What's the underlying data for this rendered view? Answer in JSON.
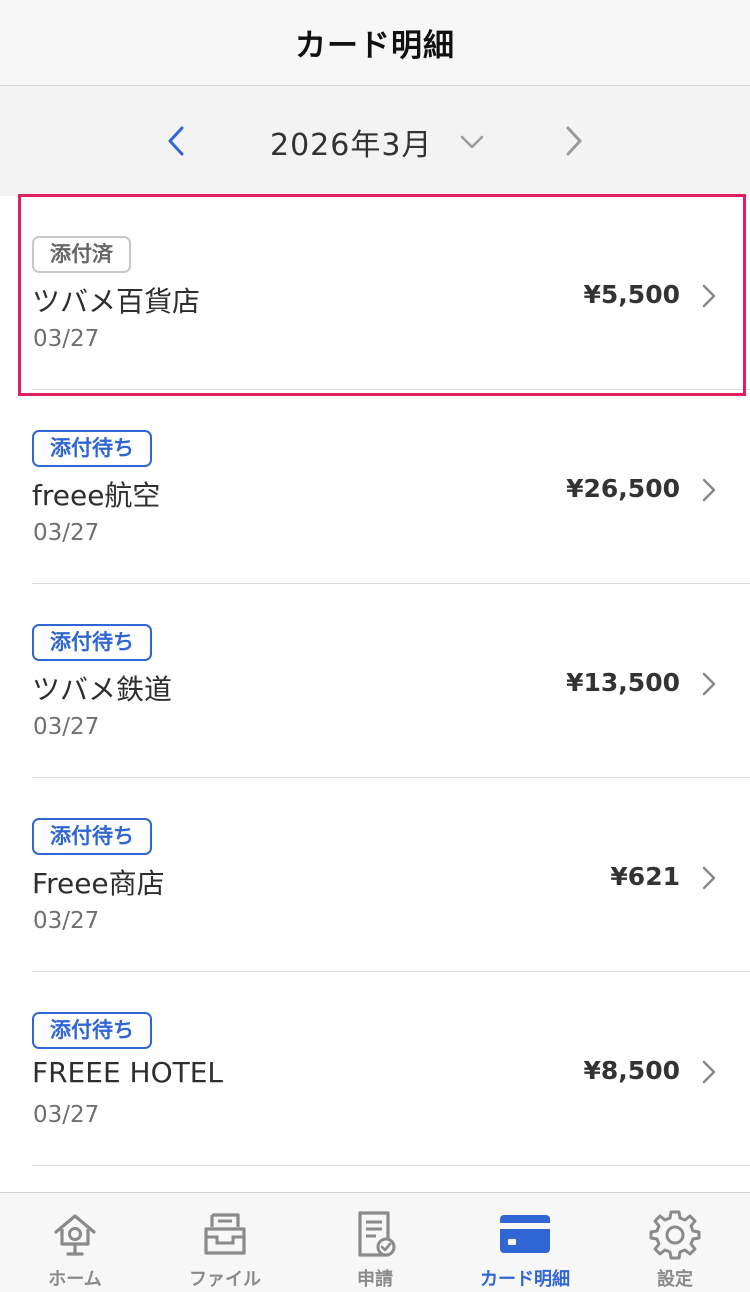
{
  "header": {
    "title": "カード明細"
  },
  "month_selector": {
    "label": "2026年3月"
  },
  "transactions": [
    {
      "status": "添付済",
      "status_type": "done",
      "merchant": "ツバメ百貨店",
      "date": "03/27",
      "amount": "¥5,500"
    },
    {
      "status": "添付待ち",
      "status_type": "waiting",
      "merchant": "freee航空",
      "date": "03/27",
      "amount": "¥26,500"
    },
    {
      "status": "添付待ち",
      "status_type": "waiting",
      "merchant": "ツバメ鉄道",
      "date": "03/27",
      "amount": "¥13,500"
    },
    {
      "status": "添付待ち",
      "status_type": "waiting",
      "merchant": "Freee商店",
      "date": "03/27",
      "amount": "¥621"
    },
    {
      "status": "添付待ち",
      "status_type": "waiting",
      "merchant": "FREEE HOTEL",
      "date": "03/27",
      "amount": "¥8,500"
    }
  ],
  "tab_bar": {
    "items": [
      {
        "label": "ホーム",
        "icon": "home-icon"
      },
      {
        "label": "ファイル",
        "icon": "file-box-icon"
      },
      {
        "label": "申請",
        "icon": "application-document-icon"
      },
      {
        "label": "カード明細",
        "icon": "credit-card-icon",
        "active": true
      },
      {
        "label": "設定",
        "icon": "gear-icon"
      }
    ]
  },
  "colors": {
    "accent": "#2f66d4",
    "highlight": "#e21f5d",
    "inactive": "#8a8a8a"
  }
}
